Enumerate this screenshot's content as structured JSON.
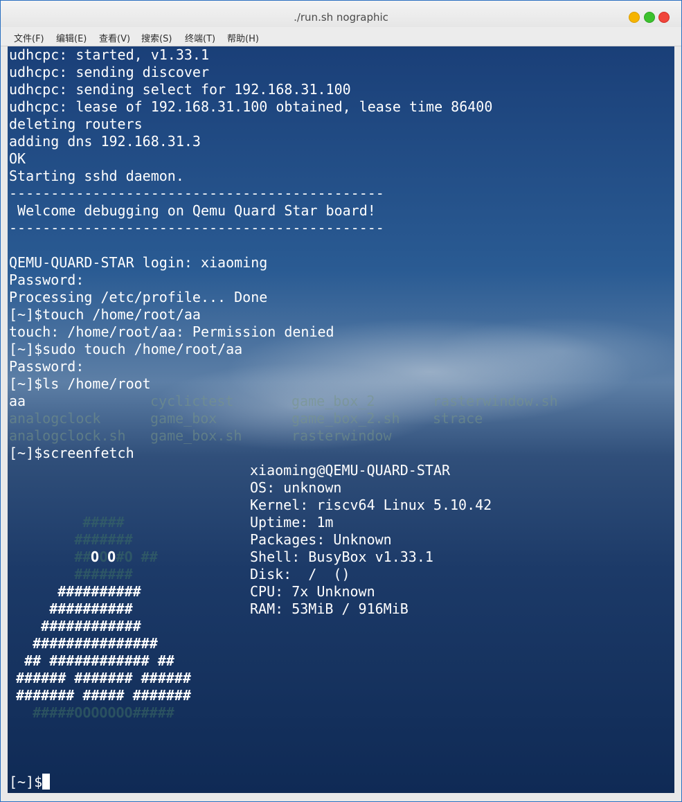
{
  "window": {
    "title": "./run.sh nographic",
    "colors": {
      "minimize": "#f6b400",
      "maximize": "#3cc12e",
      "close": "#f0453b"
    }
  },
  "menu": [
    "文件(F)",
    "编辑(E)",
    "查看(V)",
    "搜索(S)",
    "终端(T)",
    "帮助(H)"
  ],
  "terminal": {
    "lines": [
      "udhcpc: started, v1.33.1",
      "udhcpc: sending discover",
      "udhcpc: sending select for 192.168.31.100",
      "udhcpc: lease of 192.168.31.100 obtained, lease time 86400",
      "deleting routers",
      "adding dns 192.168.31.3",
      "OK",
      "Starting sshd daemon.",
      "---------------------------------------------",
      " Welcome debugging on Qemu Quard Star board!",
      "---------------------------------------------",
      "",
      "QEMU-QUARD-STAR login: xiaoming",
      "Password:",
      "Processing /etc/profile... Done",
      "[~]$touch /home/root/aa",
      "touch: /home/root/aa: Permission denied",
      "[~]$sudo touch /home/root/aa",
      "Password:",
      "[~]$ls /home/root"
    ],
    "ls_output": [
      [
        "aa",
        "cyclictest",
        "game_box_2",
        "rasterwindow.sh"
      ],
      [
        "analogclock",
        "game_box",
        "game_box_2.sh",
        "strace"
      ],
      [
        "analogclock.sh",
        "game_box.sh",
        "rasterwindow",
        ""
      ]
    ],
    "screenfetch_cmd": "[~]$screenfetch",
    "screenfetch_info": [
      "xiaoming@QEMU-QUARD-STAR",
      "OS: unknown",
      "Kernel: riscv64 Linux 5.10.42",
      "Uptime: 1m",
      "Packages: Unknown",
      "Shell: BusyBox v1.33.1",
      "Disk:  /  ()",
      "CPU: 7x Unknown",
      "RAM: 53MiB / 916MiB"
    ],
    "logo": [
      "         #####",
      "        #######",
      "        ## O #O ##",
      "        #######",
      "      ##########",
      "     ##########",
      "    ############",
      "   ###############",
      "  ## ############ ##",
      "###### ####### ######",
      "####### ##### #######",
      "  #####OOOOOOO#####"
    ],
    "logo_face": "O O",
    "prompt": "[~]$"
  }
}
